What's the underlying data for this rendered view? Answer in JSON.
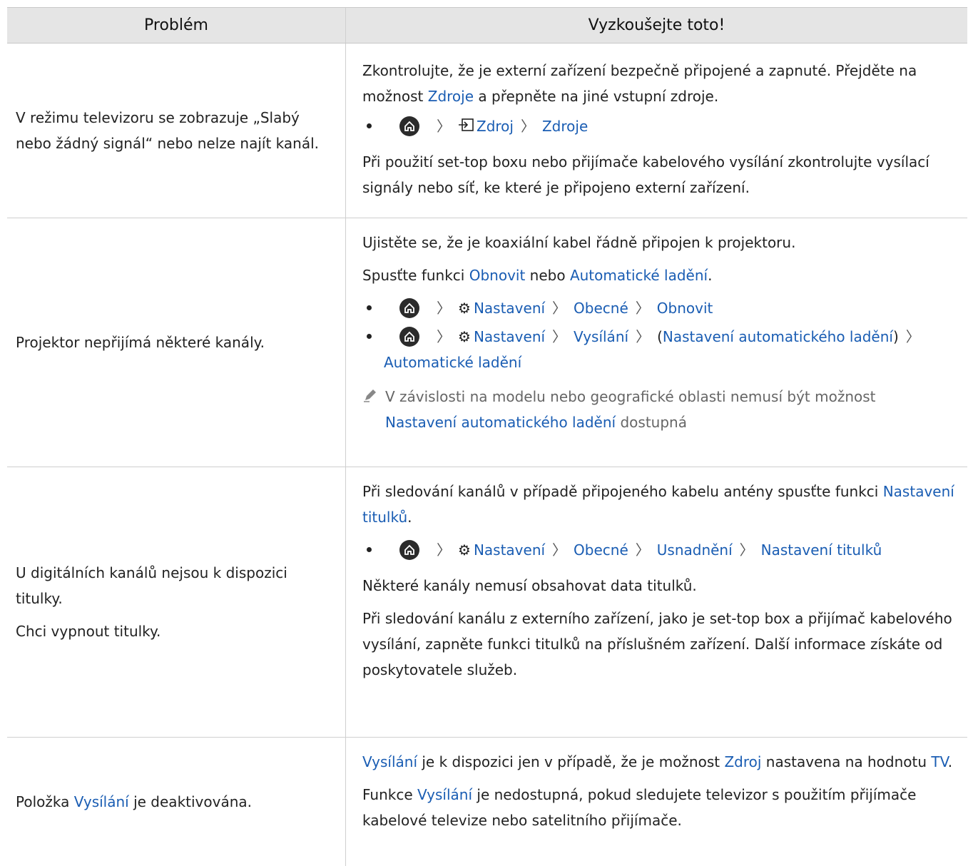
{
  "header": {
    "col1": "Problém",
    "col2": "Vyzkoušejte toto!"
  },
  "row1": {
    "problem": "V režimu televizoru se zobrazuje „Slabý nebo žádný signál“ nebo nelze najít kanál.",
    "p1_a": "Zkontrolujte, že je externí zařízení bezpečně připojené a zapnuté. Přejděte na možnost ",
    "p1_link": "Zdroje",
    "p1_b": " a přepněte na jiné vstupní zdroje.",
    "path": [
      "Zdroj",
      "Zdroje"
    ],
    "p2": "Při použití set-top boxu nebo přijímače kabelového vysílání zkontrolujte vysílací signály nebo síť, ke které je připojeno externí zařízení."
  },
  "row2": {
    "problem": "Projektor nepřijímá některé kanály.",
    "p1": "Ujistěte se, že je koaxiální kabel řádně připojen k projektoru.",
    "p2_a": "Spusťte funkci ",
    "p2_link1": "Obnovit",
    "p2_mid": " nebo ",
    "p2_link2": "Automatické ladění",
    "p2_end": ".",
    "path1": [
      "Nastavení",
      "Obecné",
      "Obnovit"
    ],
    "path2": [
      "Nastavení",
      "Vysílání",
      "Nastavení automatického ladění",
      "Automatické ladění"
    ],
    "paren_open": "(",
    "paren_close": ")",
    "note_a": "V závislosti na modelu nebo geografické oblasti nemusí být možnost",
    "note_link": "Nastavení automatického ladění",
    "note_b": " dostupná"
  },
  "row3": {
    "problem1": "U digitálních kanálů nejsou k dispozici titulky.",
    "problem2": "Chci vypnout titulky.",
    "p1_a": "Při sledování kanálů v případě připojeného kabelu antény spusťte funkci ",
    "p1_link": "Nastavení titulků",
    "p1_end": ".",
    "path": [
      "Nastavení",
      "Obecné",
      "Usnadnění",
      "Nastavení titulků"
    ],
    "p2": "Některé kanály nemusí obsahovat data titulků.",
    "p3": "Při sledování kanálu z externího zařízení, jako je set-top box a přijímač kabelového vysílání, zapněte funkci titulků na příslušném zařízení. Další informace získáte od poskytovatele služeb."
  },
  "row4": {
    "problem_a": "Položka ",
    "problem_link": "Vysílání",
    "problem_b": " je deaktivována.",
    "p1_link1": "Vysílání",
    "p1_a": " je k dispozici jen v případě, že je možnost ",
    "p1_link2": "Zdroj",
    "p1_b": " nastavena na hodnotu ",
    "p1_link3": "TV",
    "p1_end": ".",
    "p2_a": "Funkce ",
    "p2_link": "Vysílání",
    "p2_b": " je nedostupná, pokud sledujete televizor s použitím přijímače kabelové televize nebo satelitního přijímače."
  },
  "colors": {
    "link": "#1a5db3",
    "header_bg": "#e5e5e5",
    "note": "#666666"
  },
  "icons": [
    "home-icon",
    "source-icon",
    "gear-icon",
    "chevron-right-icon",
    "pencil-note-icon"
  ]
}
